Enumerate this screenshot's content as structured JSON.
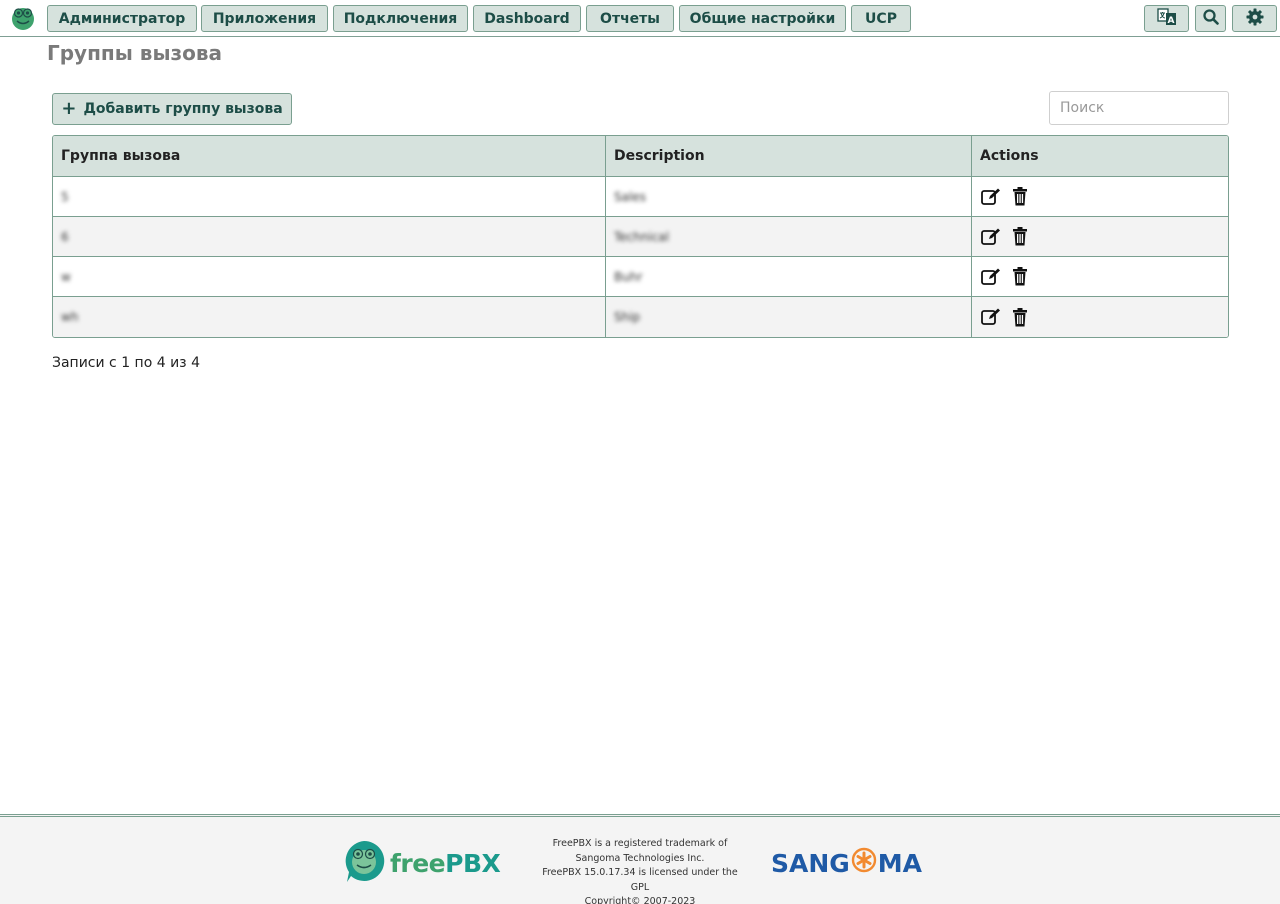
{
  "nav": {
    "items": [
      {
        "label": "Администратор"
      },
      {
        "label": "Приложения"
      },
      {
        "label": "Подключения"
      },
      {
        "label": "Dashboard"
      },
      {
        "label": "Отчеты"
      },
      {
        "label": "Общие настройки"
      },
      {
        "label": "UCP"
      }
    ],
    "icons": [
      "language-icon",
      "search-icon",
      "gear-icon"
    ]
  },
  "page": {
    "title": "Группы вызова",
    "add_button_label": "Добавить группу вызова",
    "search_placeholder": "Поиск",
    "search_value": "",
    "records_info": "Записи с 1 по 4 из 4"
  },
  "table": {
    "columns": [
      "Группа вызова",
      "Description",
      "Actions"
    ],
    "rows": [
      {
        "group": "5",
        "description": "Sales"
      },
      {
        "group": "6",
        "description": "Technical"
      },
      {
        "group": "w",
        "description": "Buhr"
      },
      {
        "group": "wh",
        "description": "Ship"
      }
    ]
  },
  "footer": {
    "brand_left_1": "free",
    "brand_left_2": "PBX",
    "legal_lines": [
      "FreePBX is a registered trademark of",
      "Sangoma Technologies Inc.",
      "FreePBX 15.0.17.34 is licensed under the",
      "GPL",
      "Copyright© 2007-2023"
    ],
    "brand_right_1": "SANG",
    "brand_right_2": "MA"
  },
  "colors": {
    "accent_bg": "#d6e2dd",
    "accent_border": "#7a9f90",
    "accent_text": "#1d4d47"
  }
}
